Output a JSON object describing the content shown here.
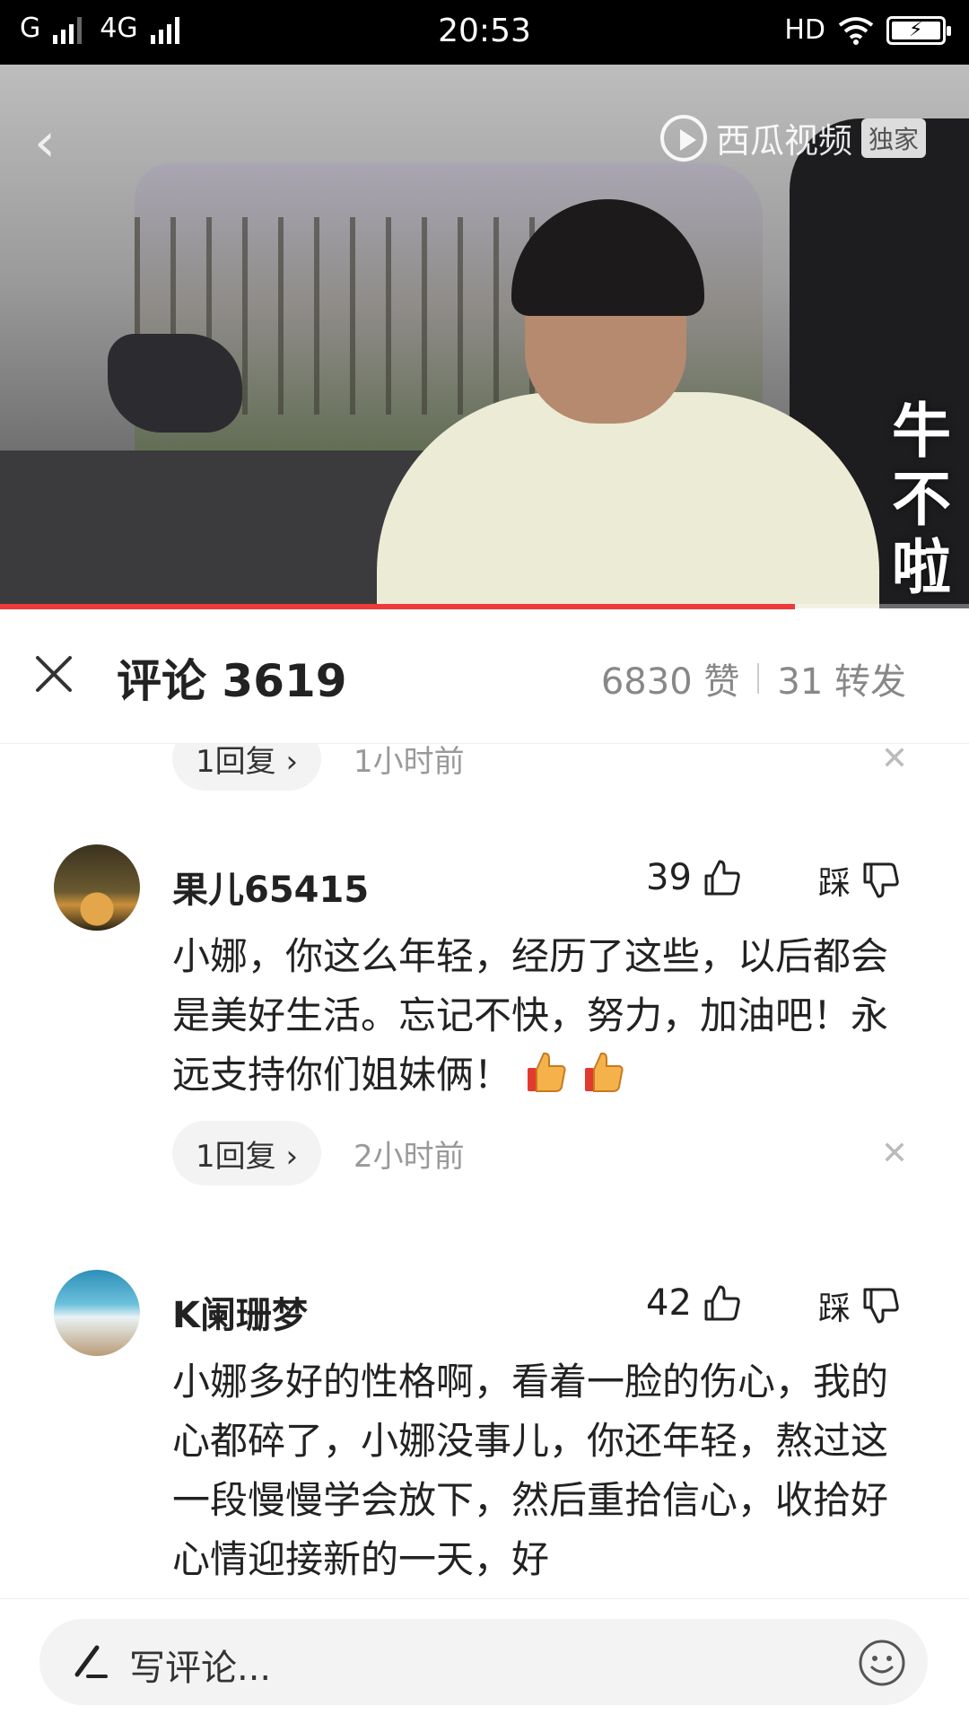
{
  "status_bar": {
    "network1": "G",
    "network2": "4G",
    "time": "20:53",
    "hd": "HD"
  },
  "video": {
    "logo_text": "西瓜视频",
    "exclusive_badge": "独家",
    "caption": "牛不啦",
    "progress_fraction": 0.82,
    "progress_color": "#ee3a3a"
  },
  "comments_header": {
    "title": "评论 3619",
    "likes": "6830 赞",
    "shares": "31 转发"
  },
  "comments": {
    "prev_reply": {
      "label": "1回复 ›",
      "time": "1小时前"
    },
    "items": [
      {
        "username": "果儿65415",
        "likes": "39",
        "dislike_label": "踩",
        "text": "小娜，你这么年轻，经历了这些，以后都会是美好生活。忘记不快，努力，加油吧！永远支持你们姐妹俩！",
        "emoji": [
          "thumbs-up",
          "thumbs-up"
        ],
        "reply_label": "1回复 ›",
        "time": "2小时前"
      },
      {
        "username": "K阑珊梦",
        "likes": "42",
        "dislike_label": "踩",
        "text": "小娜多好的性格啊，看着一脸的伤心，我的心都碎了，小娜没事儿，你还年轻，熬过这一段慢慢学会放下，然后重拾信心，收拾好心情迎接新的一天，好"
      }
    ]
  },
  "bottom_bar": {
    "placeholder": "写评论..."
  }
}
